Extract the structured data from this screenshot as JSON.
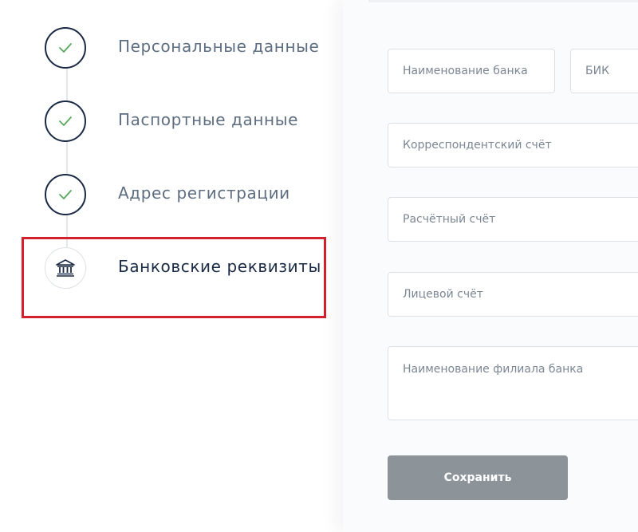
{
  "stepper": {
    "steps": [
      {
        "label": "Персональные данные",
        "status": "done",
        "icon": "check-icon"
      },
      {
        "label": "Паспортные данные",
        "status": "done",
        "icon": "check-icon"
      },
      {
        "label": "Адрес регистрации",
        "status": "done",
        "icon": "check-icon"
      },
      {
        "label": "Банковские реквизиты",
        "status": "current",
        "icon": "bank-icon"
      }
    ]
  },
  "form": {
    "bank_name_placeholder": "Наименование банка",
    "bik_placeholder": "БИК",
    "corr_account_placeholder": "Корреспондентский счёт",
    "settlement_account_placeholder": "Расчётный счёт",
    "personal_account_placeholder": "Лицевой счёт",
    "branch_name_placeholder": "Наименование филиала банка",
    "save_label": "Сохранить"
  },
  "colors": {
    "check": "#5aa85e",
    "navy": "#1b2a44",
    "highlight": "#d5202e",
    "button": "#8c9399"
  }
}
